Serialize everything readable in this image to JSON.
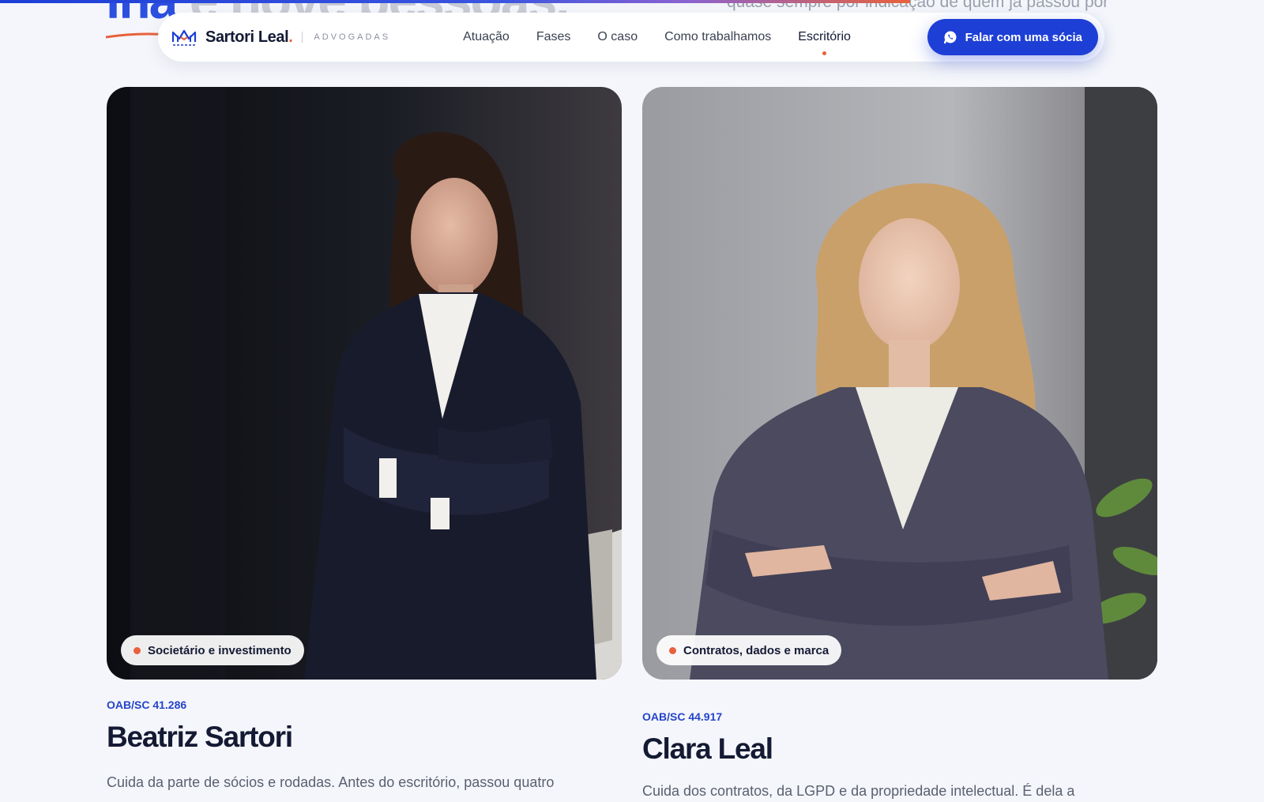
{
  "progress": {
    "percent": 72
  },
  "hero": {
    "title_accent": "lha",
    "title_rest": " e nove pessoas.",
    "subtitle": "quase sempre por indicação de quem já passou por aqui"
  },
  "header": {
    "brand_name": "Sartori Leal",
    "brand_dot": ".",
    "brand_sub": "ADVOGADAS",
    "nav": [
      {
        "label": "Atuação",
        "active": false
      },
      {
        "label": "Fases",
        "active": false
      },
      {
        "label": "O caso",
        "active": false
      },
      {
        "label": "Como trabalhamos",
        "active": false
      },
      {
        "label": "Escritório",
        "active": true
      }
    ],
    "cta_label": "Falar com uma sócia",
    "cta_icon": "whatsapp-icon"
  },
  "team": [
    {
      "tag": "Societário e investimento",
      "oab": "OAB/SC 41.286",
      "name": "Beatriz Sartori",
      "bio": "Cuida da parte de sócios e rodadas. Antes do escritório, passou quatro"
    },
    {
      "tag": "Contratos, dados e marca",
      "oab": "OAB/SC 44.917",
      "name": "Clara Leal",
      "bio": "Cuida dos contratos, da LGPD e da propriedade intelectual. É dela a"
    }
  ],
  "colors": {
    "brand_blue": "#1d3fd6",
    "accent_coral": "#e8613c",
    "ink": "#141a33",
    "page_bg": "#f4f6fb"
  }
}
